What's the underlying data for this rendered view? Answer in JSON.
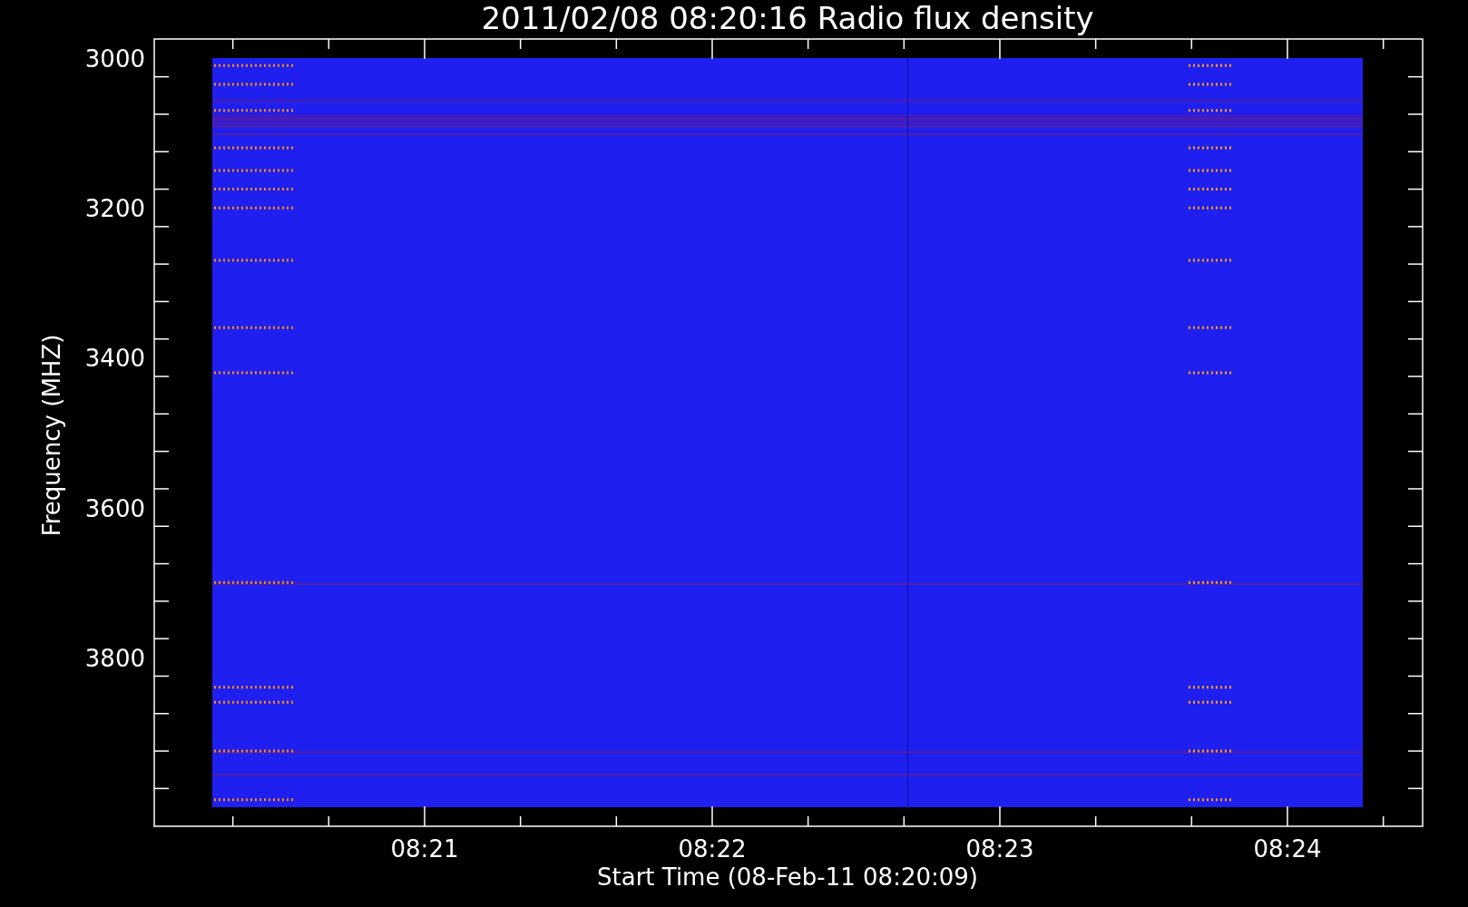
{
  "title": "2011/02/08 08:20:16 Radio flux density",
  "ylabel": "Frequency (MHZ)",
  "xlabel": "Start Time (08-Feb-11 08:20:09)",
  "yticks": [
    "3000",
    "3200",
    "3400",
    "3600",
    "3800"
  ],
  "xticks": [
    "08:21",
    "08:22",
    "08:23",
    "08:24"
  ]
}
